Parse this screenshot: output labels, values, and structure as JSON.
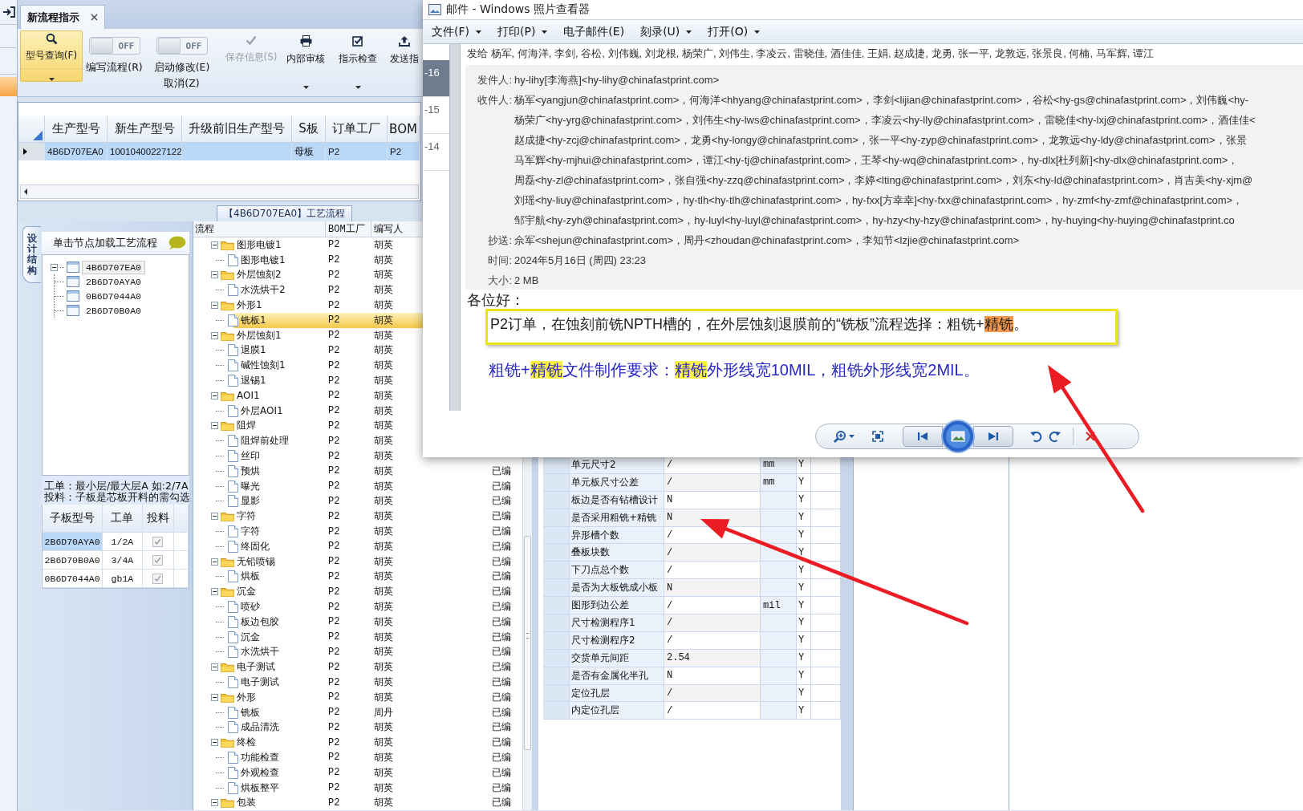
{
  "app": {
    "tab": {
      "label": "新流程指示",
      "selected": true
    },
    "toolbar": [
      {
        "kind": "button",
        "label": "型号查询(F)",
        "active": true,
        "disabled": false,
        "dropdown": true
      },
      {
        "kind": "toggle",
        "label": "编写流程(R)",
        "switch_text": "OFF",
        "on": false
      },
      {
        "kind": "toggle",
        "label": "启动修改(E)",
        "second_label": "取消(Z)",
        "switch_text": "OFF",
        "on": false
      },
      {
        "kind": "button",
        "label": "保存信息(S)",
        "active": false,
        "disabled": true,
        "dropdown": false
      },
      {
        "kind": "button",
        "label": "内部审核",
        "active": false,
        "disabled": false,
        "dropdown": true
      },
      {
        "kind": "button",
        "label": "指示检查",
        "active": false,
        "disabled": false,
        "dropdown": true
      },
      {
        "kind": "button",
        "label": "发送指",
        "active": false,
        "disabled": false,
        "dropdown": false
      }
    ],
    "grid": {
      "columns": [
        "生产型号",
        "新生产型号",
        "升级前旧生产型号",
        "S板",
        "订单工厂",
        "BOM"
      ],
      "rows": [
        {
          "cells": [
            "4B6D707EA0",
            "10010400227122",
            null,
            "母板",
            "P2",
            "P2"
          ],
          "selected": true
        }
      ]
    },
    "structure_panel": {
      "side_tab": "设计结构",
      "hint": "单击节点加载工艺流程",
      "tree": [
        {
          "label": "4B6D707EA0",
          "expanded": true,
          "selected": true,
          "children": [
            {
              "label": "2B6D70AYA0",
              "selected": false
            },
            {
              "label": "0B6D7044A0",
              "selected": false
            },
            {
              "label": "2B6D70B0A0",
              "selected": false
            }
          ]
        }
      ],
      "note": [
        "工单：最小层/最大层A 如:2/7A",
        "投料：子板是芯板开料的需勾选"
      ],
      "sub_table": {
        "columns": [
          "子板型号",
          "工单",
          "投料"
        ],
        "rows": [
          {
            "cells": [
              "2B6D70AYA0",
              "1/2A"
            ],
            "checked": true,
            "selected": true
          },
          {
            "cells": [
              "2B6D70B0A0",
              "3/4A"
            ],
            "checked": true,
            "selected": false
          },
          {
            "cells": [
              "0B6D7044A0",
              "gb1A"
            ],
            "checked": true,
            "selected": false
          }
        ]
      }
    },
    "flow_title": "【4B6D707EA0】工艺流程",
    "flow_tree": {
      "columns": [
        "流程",
        "BOM工厂",
        "编写人"
      ],
      "rows": [
        {
          "label": "图形电镀1",
          "factory": "P2",
          "author": "胡英",
          "expanded": true,
          "selected": false,
          "children": [
            {
              "label": "图形电镀1",
              "factory": "P2",
              "author": "胡英",
              "selected": false
            }
          ]
        },
        {
          "label": "外层蚀刻2",
          "factory": "P2",
          "author": "胡英",
          "expanded": true,
          "selected": false,
          "children": [
            {
              "label": "水洗烘干2",
              "factory": "P2",
              "author": "胡英",
              "selected": false
            }
          ]
        },
        {
          "label": "外形1",
          "factory": "P2",
          "author": "胡英",
          "expanded": true,
          "selected": false,
          "children": [
            {
              "label": "铣板1",
              "factory": "P2",
              "author": "胡英",
              "selected": true
            }
          ]
        },
        {
          "label": "外层蚀刻1",
          "factory": "P2",
          "author": "胡英",
          "expanded": true,
          "selected": false,
          "children": [
            {
              "label": "退膜1",
              "factory": "P2",
              "author": "胡英",
              "selected": false
            },
            {
              "label": "碱性蚀刻1",
              "factory": "P2",
              "author": "胡英",
              "selected": false
            },
            {
              "label": "退锡1",
              "factory": "P2",
              "author": "胡英",
              "selected": false
            }
          ]
        },
        {
          "label": "AOI1",
          "factory": "P2",
          "author": "胡英",
          "expanded": true,
          "selected": false,
          "children": [
            {
              "label": "外层AOI1",
              "factory": "P2",
              "author": "胡英",
              "selected": false
            }
          ]
        },
        {
          "label": "阻焊",
          "factory": "P2",
          "author": "胡英",
          "expanded": true,
          "selected": false,
          "children": [
            {
              "label": "阻焊前处理",
              "factory": "P2",
              "author": "胡英",
              "selected": false
            },
            {
              "label": "丝印",
              "factory": "P2",
              "author": "胡英",
              "selected": false
            },
            {
              "label": "预烘",
              "factory": "P2",
              "author": "胡英",
              "selected": false,
              "status": "已编"
            },
            {
              "label": "曝光",
              "factory": "P2",
              "author": "胡英",
              "selected": false,
              "status": "已编"
            },
            {
              "label": "显影",
              "factory": "P2",
              "author": "胡英",
              "selected": false,
              "status": "已编"
            }
          ]
        },
        {
          "label": "字符",
          "factory": "P2",
          "author": "胡英",
          "expanded": true,
          "selected": false,
          "status": "已编",
          "children": [
            {
              "label": "字符",
              "factory": "P2",
              "author": "胡英",
              "selected": false,
              "status": "已编"
            },
            {
              "label": "终固化",
              "factory": "P2",
              "author": "胡英",
              "selected": false,
              "status": "已编"
            }
          ]
        },
        {
          "label": "无铅喷锡",
          "factory": "P2",
          "author": "胡英",
          "expanded": true,
          "selected": false,
          "status": "已编",
          "children": [
            {
              "label": "烘板",
              "factory": "P2",
              "author": "胡英",
              "selected": false,
              "status": "已编"
            }
          ]
        },
        {
          "label": "沉金",
          "factory": "P2",
          "author": "胡英",
          "expanded": true,
          "selected": false,
          "status": "已编",
          "children": [
            {
              "label": "喷砂",
              "factory": "P2",
              "author": "胡英",
              "selected": false,
              "status": "已编"
            },
            {
              "label": "板边包胶",
              "factory": "P2",
              "author": "胡英",
              "selected": false,
              "status": "已编"
            },
            {
              "label": "沉金",
              "factory": "P2",
              "author": "胡英",
              "selected": false,
              "status": "已编"
            },
            {
              "label": "水洗烘干",
              "factory": "P2",
              "author": "胡英",
              "selected": false,
              "status": "已编"
            }
          ]
        },
        {
          "label": "电子测试",
          "factory": "P2",
          "author": "胡英",
          "expanded": true,
          "selected": false,
          "status": "已编",
          "children": [
            {
              "label": "电子测试",
              "factory": "P2",
              "author": "胡英",
              "selected": false,
              "status": "已编"
            }
          ]
        },
        {
          "label": "外形",
          "factory": "P2",
          "author": "胡英",
          "expanded": true,
          "selected": false,
          "status": "已编",
          "children": [
            {
              "label": "铣板",
              "factory": "P2",
              "author": "周丹",
              "selected": false,
              "status": "已编"
            },
            {
              "label": "成品清洗",
              "factory": "P2",
              "author": "胡英",
              "selected": false,
              "status": "已编"
            }
          ]
        },
        {
          "label": "终检",
          "factory": "P2",
          "author": "胡英",
          "expanded": true,
          "selected": false,
          "status": "已编",
          "children": [
            {
              "label": "功能检查",
              "factory": "P2",
              "author": "胡英",
              "selected": false,
              "status": "已编"
            },
            {
              "label": "外观检查",
              "factory": "P2",
              "author": "胡英",
              "selected": false,
              "status": "已编"
            },
            {
              "label": "烘板整平",
              "factory": "P2",
              "author": "胡英",
              "selected": false,
              "status": "已编"
            }
          ]
        },
        {
          "label": "包装",
          "factory": "P2",
          "author": "胡英",
          "expanded": true,
          "selected": false,
          "status": "已编"
        }
      ]
    },
    "param_table": {
      "rows": [
        {
          "name": "单元尺寸2",
          "value": "/",
          "unit": "mm",
          "flag": "Y"
        },
        {
          "name": "单元板尺寸公差",
          "value": "/",
          "unit": "mm",
          "flag": "Y"
        },
        {
          "name": "板边是否有钻槽设计",
          "value": "N",
          "flag": "Y"
        },
        {
          "name": "是否采用粗铣+精铣",
          "value": "N",
          "flag": "Y"
        },
        {
          "name": "异形槽个数",
          "value": "/",
          "flag": "Y"
        },
        {
          "name": "叠板块数",
          "value": "/",
          "flag": "Y"
        },
        {
          "name": "下刀点总个数",
          "value": "/",
          "flag": "Y"
        },
        {
          "name": "是否为大板铣成小板",
          "value": "N",
          "flag": "Y"
        },
        {
          "name": "图形到边公差",
          "value": "/",
          "unit": "mil",
          "flag": "Y"
        },
        {
          "name": "尺寸检测程序1",
          "value": "/",
          "flag": "Y"
        },
        {
          "name": "尺寸检测程序2",
          "value": "/",
          "flag": "Y"
        },
        {
          "name": "交货单元间距",
          "value": "2.54",
          "flag": "Y"
        },
        {
          "name": "是否有金属化半孔",
          "value": "N",
          "flag": "Y"
        },
        {
          "name": "定位孔层",
          "value": "/",
          "flag": "Y"
        },
        {
          "name": "内定位孔层",
          "value": "/",
          "flag": "Y"
        }
      ]
    }
  },
  "viewer": {
    "title": "邮件 - Windows 照片查看器",
    "menu": [
      {
        "label": "文件(F)",
        "dropdown": true
      },
      {
        "label": "打印(P)",
        "dropdown": true
      },
      {
        "label": "电子邮件(E)",
        "dropdown": false
      },
      {
        "label": "刻录(U)",
        "dropdown": true
      },
      {
        "label": "打开(O)",
        "dropdown": true
      }
    ],
    "email": {
      "nav": [
        {
          "label": "-16",
          "selected": true
        },
        {
          "label": "-15",
          "selected": false
        },
        {
          "label": "-14",
          "selected": false
        }
      ],
      "to_line": "发给 杨军, 何海洋, 李剑, 谷松, 刘伟巍, 刘龙根, 杨荣广, 刘伟生, 李凌云, 雷晓佳, 酒佳佳, 王娟, 赵成捷, 龙勇, 张一平, 龙敦远, 张景良, 何楠, 马军辉, 谭江",
      "fields": [
        {
          "label": "发件人:",
          "lines": [
            "hy-lihy[李海燕]<hy-lihy@chinafastprint.com>"
          ]
        },
        {
          "label": "收件人:",
          "lines": [
            "杨军<yangjun@chinafastprint.com>，何海洋<hhyang@chinafastprint.com>，李剑<lijian@chinafastprint.com>，谷松<hy-gs@chinafastprint.com>，刘伟巍<hy-",
            "杨荣广<hy-yrg@chinafastprint.com>，刘伟生<hy-lws@chinafastprint.com>，李凌云<hy-lly@chinafastprint.com>，雷晓佳<hy-lxj@chinafastprint.com>，酒佳佳<",
            "赵成捷<hy-zcj@chinafastprint.com>，龙勇<hy-longy@chinafastprint.com>，张一平<hy-zyp@chinafastprint.com>，龙敦远<hy-ldy@chinafastprint.com>，张景",
            "马军辉<hy-mjhui@chinafastprint.com>，谭江<hy-tj@chinafastprint.com>，王琴<hy-wq@chinafastprint.com>，hy-dlx[杜列新]<hy-dlx@chinafastprint.com>，",
            "周磊<hy-zl@chinafastprint.com>，张自强<hy-zzq@chinafastprint.com>，李婷<lting@chinafastprint.com>，刘东<hy-ld@chinafastprint.com>，肖吉美<hy-xjm@",
            "刘瑶<hy-liuy@chinafastprint.com>，hy-tlh<hy-tlh@chinafastprint.com>，hy-fxx[方幸幸]<hy-fxx@chinafastprint.com>，hy-zmf<hy-zmf@chinafastprint.com>，",
            "邹宇航<hy-zyh@chinafastprint.com>，hy-luyl<hy-luyl@chinafastprint.com>，hy-hzy<hy-hzy@chinafastprint.com>，hy-huying<hy-huying@chinafastprint.co"
          ]
        },
        {
          "label": "抄送:",
          "lines": [
            "佘军<shejun@chinafastprint.com>，周丹<zhoudan@chinafastprint.com>，李知节<lzjie@chinafastprint.com>"
          ]
        },
        {
          "label": "时间:",
          "lines": [
            "2024年5月16日 (周四) 23:23"
          ]
        },
        {
          "label": "大小:",
          "lines": [
            "2 MB"
          ]
        }
      ],
      "greeting": "各位好：",
      "paragraphs": [
        {
          "kind": "framed",
          "segments": [
            {
              "text": "P2订单，在蚀刻前铣NPTH槽的，在外层蚀刻退膜前的“铣板”流程选择：粗铣+"
            },
            {
              "text": "精铣",
              "color": "#f59a4c"
            },
            {
              "text": "。"
            }
          ]
        },
        {
          "kind": "plain",
          "segments": [
            {
              "text": "粗铣+"
            },
            {
              "text": "精铣",
              "color": "#fbf04a"
            },
            {
              "text": "文件制作要求："
            },
            {
              "text": "精铣",
              "color": "#fbf04a"
            },
            {
              "text": "外形线宽10MIL，粗铣外形线宽2MIL。"
            }
          ]
        }
      ]
    }
  }
}
